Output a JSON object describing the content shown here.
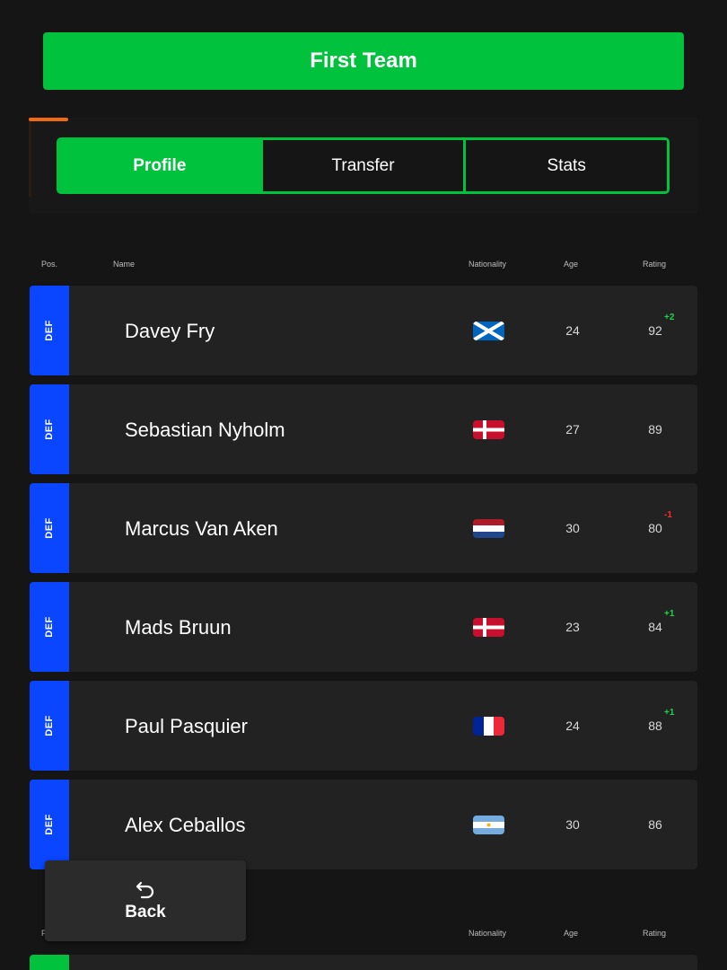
{
  "header": {
    "title": "First Team"
  },
  "tabs": [
    {
      "label": "Profile",
      "active": true
    },
    {
      "label": "Transfer",
      "active": false
    },
    {
      "label": "Stats",
      "active": false
    }
  ],
  "columns": {
    "pos": "Pos.",
    "name": "Name",
    "nationality": "Nationality",
    "age": "Age",
    "rating": "Rating"
  },
  "players": [
    {
      "pos": "DEF",
      "name": "Davey Fry",
      "nationality": "scotland-flag",
      "age": "24",
      "rating": "92",
      "delta": "+2"
    },
    {
      "pos": "DEF",
      "name": "Sebastian Nyholm",
      "nationality": "denmark-flag",
      "age": "27",
      "rating": "89",
      "delta": ""
    },
    {
      "pos": "DEF",
      "name": "Marcus Van Aken",
      "nationality": "netherlands-flag",
      "age": "30",
      "rating": "80",
      "delta": "-1"
    },
    {
      "pos": "DEF",
      "name": "Mads Bruun",
      "nationality": "denmark-flag",
      "age": "23",
      "rating": "84",
      "delta": "+1"
    },
    {
      "pos": "DEF",
      "name": "Paul Pasquier",
      "nationality": "france-flag",
      "age": "24",
      "rating": "88",
      "delta": "+1"
    },
    {
      "pos": "DEF",
      "name": "Alex Ceballos",
      "nationality": "argentina-flag",
      "age": "30",
      "rating": "86",
      "delta": ""
    }
  ],
  "back_button": {
    "label": "Back",
    "icon": "undo-arrow-icon"
  },
  "colors": {
    "background": "#151515",
    "accent_green": "#00c23d",
    "defender_blue": "#0a45ff",
    "tab_highlight_orange": "#f26a10",
    "rating_up": "#1fd34a",
    "rating_down": "#ff2a2a"
  }
}
